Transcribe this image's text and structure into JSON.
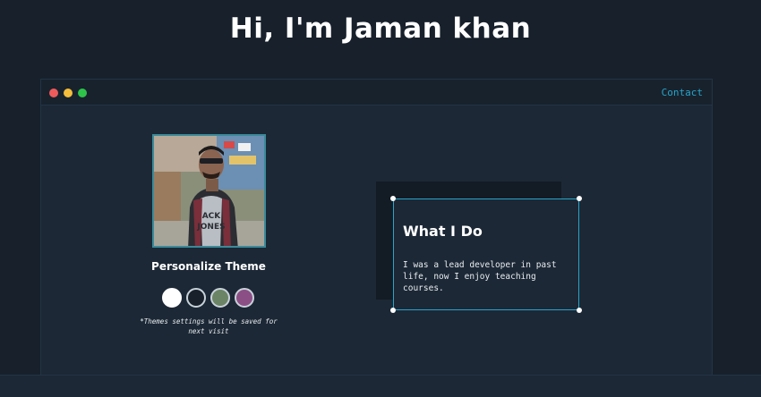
{
  "header": {
    "title": "Hi, I'm Jaman khan"
  },
  "window": {
    "controls": [
      "close-dot",
      "minimize-dot",
      "maximize-dot"
    ],
    "nav": {
      "contact_label": "Contact"
    }
  },
  "profile": {
    "photo_alt": "profile photo",
    "personalize_title": "Personalize Theme",
    "themes": [
      {
        "name": "light",
        "color": "#ffffff"
      },
      {
        "name": "dark",
        "color": "#17202b"
      },
      {
        "name": "green",
        "color": "#6b8465"
      },
      {
        "name": "purple",
        "color": "#8b4f86"
      }
    ],
    "note": "*Themes settings will be saved for next visit"
  },
  "about": {
    "title": "What I Do",
    "text": "I was a lead developer in past life, now I enjoy teaching courses."
  },
  "colors": {
    "background": "#17202b",
    "panel": "#1c2836",
    "accent": "#27a5c9"
  }
}
